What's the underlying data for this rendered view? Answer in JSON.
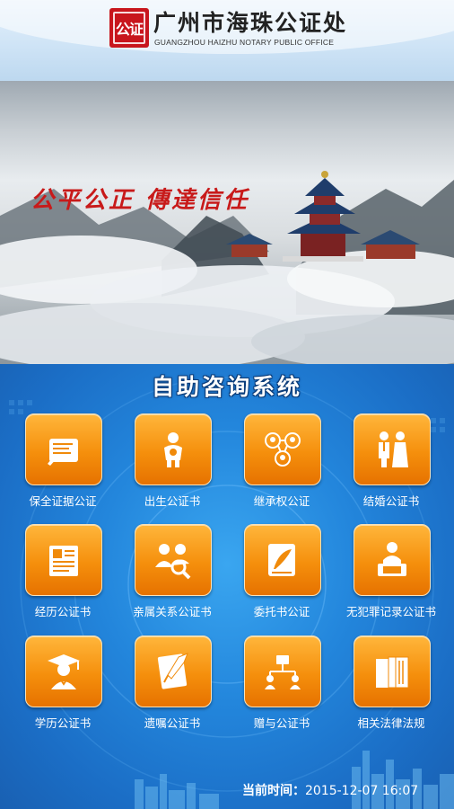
{
  "header": {
    "logo_text": "公证",
    "title_cn": "广州市海珠公证处",
    "title_en": "GUANGZHOU HAIZHU NOTARY PUBLIC OFFICE"
  },
  "banner": {
    "slogan": "公平公正 傳達信任"
  },
  "main": {
    "system_title": "自助咨询系统",
    "tiles": [
      {
        "label": "保全证据公证",
        "icon": "document-pen-icon"
      },
      {
        "label": "出生公证书",
        "icon": "baby-icon"
      },
      {
        "label": "继承权公证",
        "icon": "inheritance-people-icon"
      },
      {
        "label": "结婚公证书",
        "icon": "couple-icon"
      },
      {
        "label": "经历公证书",
        "icon": "resume-document-icon"
      },
      {
        "label": "亲属关系公证书",
        "icon": "relatives-search-icon"
      },
      {
        "label": "委托书公证",
        "icon": "proxy-document-icon"
      },
      {
        "label": "无犯罪记录公证书",
        "icon": "person-computer-icon"
      },
      {
        "label": "学历公证书",
        "icon": "graduate-icon"
      },
      {
        "label": "遗嘱公证书",
        "icon": "will-document-icon"
      },
      {
        "label": "赠与公证书",
        "icon": "gift-transfer-icon"
      },
      {
        "label": "相关法律法规",
        "icon": "law-books-icon"
      }
    ],
    "time_label": "当前时间：",
    "time_value": "2015-12-07 16:07"
  },
  "colors": {
    "accent_orange": "#f58f0c",
    "background_blue": "#2386dc",
    "brand_red": "#c8161d"
  }
}
